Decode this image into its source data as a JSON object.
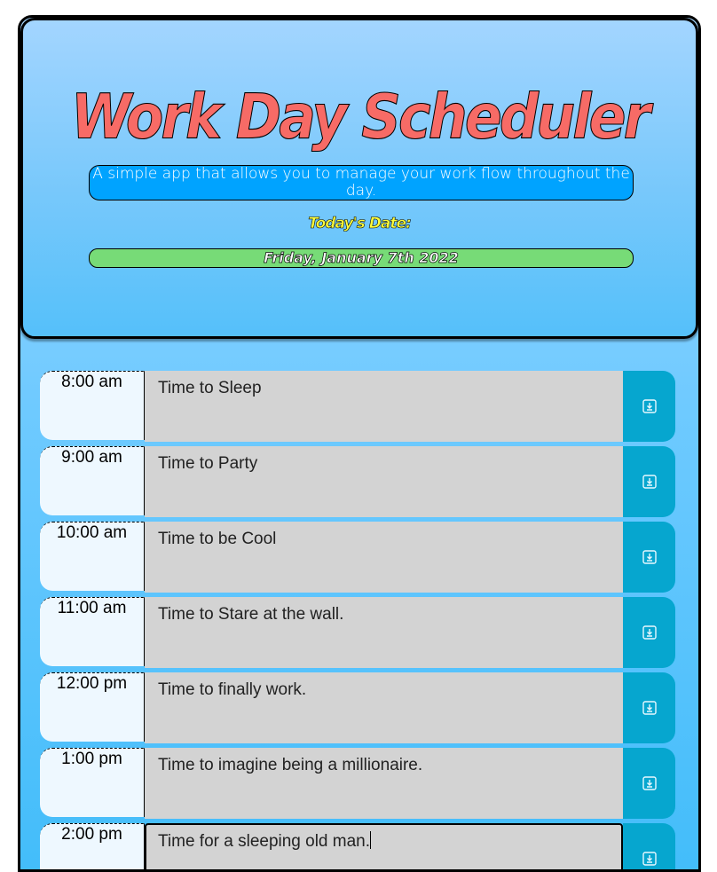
{
  "header": {
    "title": "Work Day Scheduler",
    "subtitle": "A simple app that allows you to manage your work flow throughout the day.",
    "today_label": "Today's Date:",
    "current_date": "Friday, January 7th 2022"
  },
  "colors": {
    "title": "#f76b66",
    "subtitle_bg": "#00a3ff",
    "today_label": "#ffff3c",
    "date_bar_bg": "#77db77",
    "description_bg": "#d3d3d3",
    "save_button_bg": "#06a6cf"
  },
  "schedule": [
    {
      "hour": "8:00 am",
      "description": "Time to Sleep",
      "save_icon": "save-icon"
    },
    {
      "hour": "9:00 am",
      "description": "Time to Party",
      "save_icon": "save-icon"
    },
    {
      "hour": "10:00 am",
      "description": "Time to be Cool",
      "save_icon": "save-icon"
    },
    {
      "hour": "11:00 am",
      "description": "Time to Stare at the wall.",
      "save_icon": "save-icon"
    },
    {
      "hour": "12:00 pm",
      "description": "Time to finally work.",
      "save_icon": "save-icon"
    },
    {
      "hour": "1:00 pm",
      "description": "Time to imagine being a millionaire.",
      "save_icon": "save-icon"
    },
    {
      "hour": "2:00 pm",
      "description": "Time for a sleeping old man.",
      "save_icon": "save-icon",
      "focused": true
    }
  ]
}
